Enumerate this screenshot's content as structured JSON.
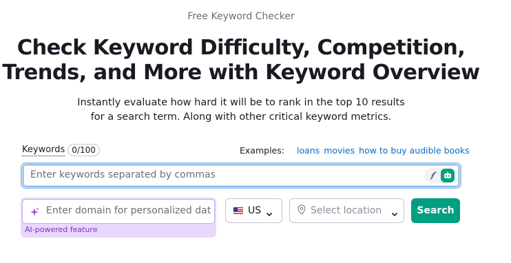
{
  "header": {
    "eyebrow": "Free Keyword Checker",
    "title": "Check Keyword Difficulty, Competition, Trends, and More with Keyword Overview",
    "subtitle": "Instantly evaluate how hard it will be to rank in the top 10 results for a search term. Along with other critical keyword metrics."
  },
  "keywords": {
    "label": "Keywords",
    "count": "0/100",
    "placeholder": "Enter keywords separated by commas",
    "value": ""
  },
  "examples": {
    "label": "Examples:",
    "links": [
      "loans",
      "movies",
      "how to buy audible books"
    ]
  },
  "domain": {
    "placeholder": "Enter domain for personalized data",
    "value": "",
    "ai_note": "AI-powered feature"
  },
  "country": {
    "code": "US",
    "flag_icon": "us-flag-icon"
  },
  "location": {
    "placeholder": "Select location"
  },
  "search_button": {
    "label": "Search"
  },
  "colors": {
    "accent_green": "#009f81",
    "link_blue": "#006dca",
    "ai_purple": "#8e46dc",
    "input_focus": "#2e7dd8"
  }
}
